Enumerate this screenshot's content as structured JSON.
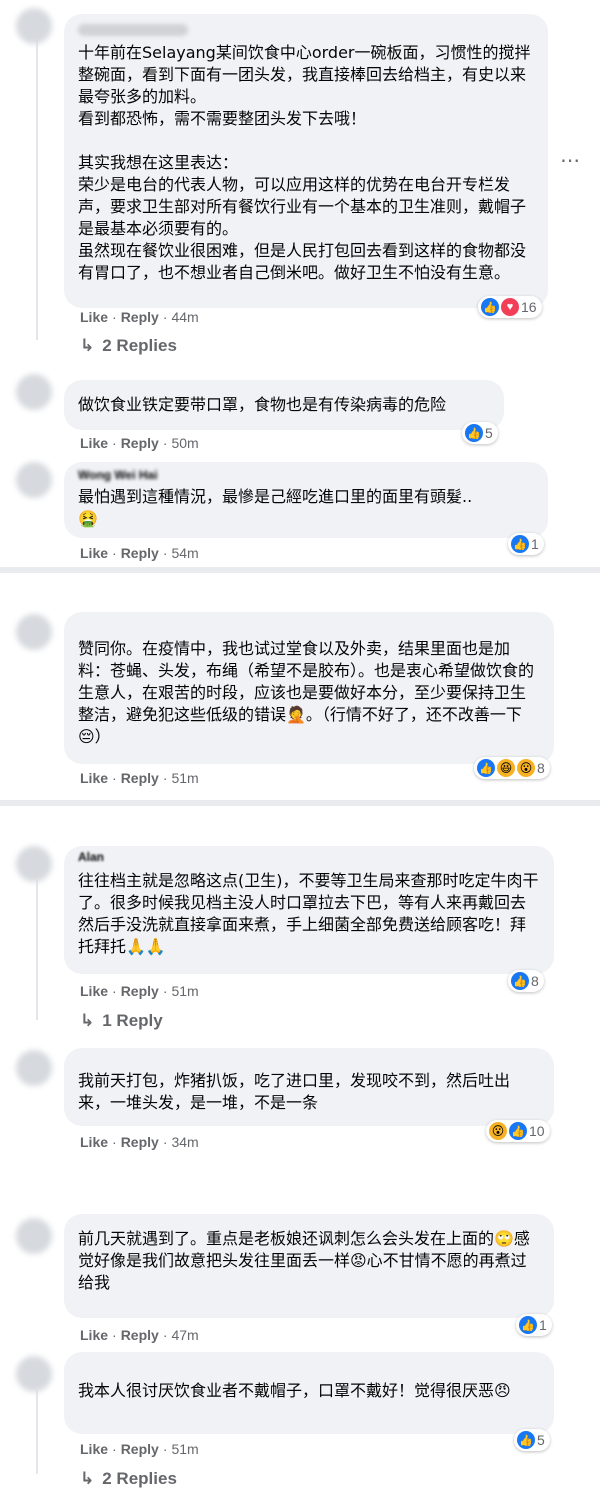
{
  "comments": [
    {
      "text": "十年前在Selayang某间饮食中心order一碗板面，习惯性的搅拌整碗面，看到下面有一团头发，我直接棒回去给档主，有史以来最夸张多的加料。\n看到都恐怖，需不需要整团头发下去哦！\n\n其实我想在这里表达：\n荣少是电台的代表人物，可以应用这样的优势在电台开专栏发声，要求卫生部对所有餐饮行业有一个基本的卫生准则，戴帽子是最基本必须要有的。\n虽然现在餐饮业很困难，但是人民打包回去看到这样的食物都没有胃口了，也不想业者自己倒米吧。做好卫生不怕没有生意。",
      "like": "Like",
      "reply": "Reply",
      "time": "44m",
      "reaction_count": "16",
      "replies": "2 Replies"
    },
    {
      "text": "做饮食业铁定要带口罩，食物也是有传染病毒的危险",
      "like": "Like",
      "reply": "Reply",
      "time": "50m",
      "reaction_count": "5"
    },
    {
      "name": "Wong Wei Hai",
      "text": "最怕遇到這種情況，最慘是己經吃進口里的面里有頭髮..\n🤮",
      "like": "Like",
      "reply": "Reply",
      "time": "54m",
      "reaction_count": "1"
    },
    {
      "text": "赞同你。在疫情中，我也试过堂食以及外卖，结果里面也是加料：苍蝇、头发，布绳（希望不是胶布）。也是衷心希望做饮食的生意人，在艰苦的时段，应该也是要做好本分，至少要保持卫生整洁，避免犯这些低级的错误🤦。（行情不好了，还不改善一下😔）",
      "like": "Like",
      "reply": "Reply",
      "time": "51m",
      "reaction_count": "8"
    },
    {
      "name": "Alan",
      "text": "往往档主就是忽略这点(卫生)，不要等卫生局来查那时吃定牛肉干了。很多时候我见档主没人时口罩拉去下巴，等有人来再戴回去然后手没洗就直接拿面来煮，手上细菌全部免费送给顾客吃！拜托拜托🙏🙏",
      "like": "Like",
      "reply": "Reply",
      "time": "51m",
      "reaction_count": "8",
      "replies": "1 Reply"
    },
    {
      "text": "我前天打包，炸猪扒饭，吃了进口里，发现咬不到，然后吐出来，一堆头发，是一堆，不是一条",
      "like": "Like",
      "reply": "Reply",
      "time": "34m",
      "reaction_count": "10"
    },
    {
      "text": "前几天就遇到了。重点是老板娘还讽刺怎么会头发在上面的🙄感觉好像是我们故意把头发往里面丢一样😡心不甘情不愿的再煮过给我",
      "like": "Like",
      "reply": "Reply",
      "time": "47m",
      "reaction_count": "1"
    },
    {
      "text": "我本人很讨厌饮食业者不戴帽子，口罩不戴好！觉得很厌恶😠",
      "like": "Like",
      "reply": "Reply",
      "time": "51m",
      "reaction_count": "5",
      "replies": "2 Replies"
    }
  ],
  "icons": {
    "like": "thumbs-up-icon",
    "love": "heart-icon",
    "reply_arrow": "reply-arrow-icon",
    "more": "more-dots-icon"
  },
  "colors": {
    "like_blue": "#1877f2",
    "love_red": "#f33e58",
    "bubble": "#f0f2f5",
    "meta": "#65676b"
  }
}
